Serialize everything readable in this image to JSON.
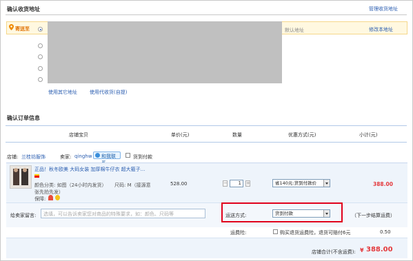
{
  "address_section": {
    "title": "确认收货地址",
    "manage_link": "管理收货地址",
    "send_to_label": "寄送至",
    "default_label": "默认地址",
    "edit_link": "修改本地址",
    "use_other_address": "使用其它地址",
    "use_pickup_point": "使用代收货(自提)"
  },
  "order_section": {
    "title": "确认订单信息",
    "columns": [
      "店铺宝贝",
      "单价(元)",
      "数量",
      "优惠方式(元)",
      "小计(元)"
    ]
  },
  "shop": {
    "label": "店铺:",
    "name": "兰桂坊服饰",
    "seller_label": "卖家:",
    "seller_name": "qinghw",
    "contact_label": "和我联系",
    "cod_label": "货到付款"
  },
  "item": {
    "title": "正品！秋冬欧美 大码女装 加厚棉牛仔衣 超大箍子...",
    "color_info": "颜色分类: 如图（24小时内发货）",
    "size_info": "尺码: M（接源意",
    "continue_info": "张先拍先发）",
    "guarantee_label": "保障:",
    "price": "528.00",
    "quantity": "1",
    "qty_minus": "−",
    "qty_plus": "+",
    "discount_option": "省140元:货到付款价",
    "subtotal": "388.00"
  },
  "message": {
    "label": "给卖家留言:",
    "placeholder": "选填，可以告诉卖家您对商品的特殊要求，如：颜色、尺码等"
  },
  "shipping": {
    "label": "运送方式:",
    "selected": "货到付款",
    "note": "（下一步结算运费）",
    "insurance_label": "运费险:",
    "insurance_text": "购买退货运费险，退货可赔付6元",
    "insurance_price": "0.50"
  },
  "total": {
    "label": "店铺合计(不含运费):",
    "currency": "¥",
    "amount": "388.00"
  },
  "colors": {
    "accent_blue": "#2a5db0",
    "price_red": "#e4393c",
    "highlight_red": "#e0001b",
    "row_bg": "#eef4fb"
  }
}
